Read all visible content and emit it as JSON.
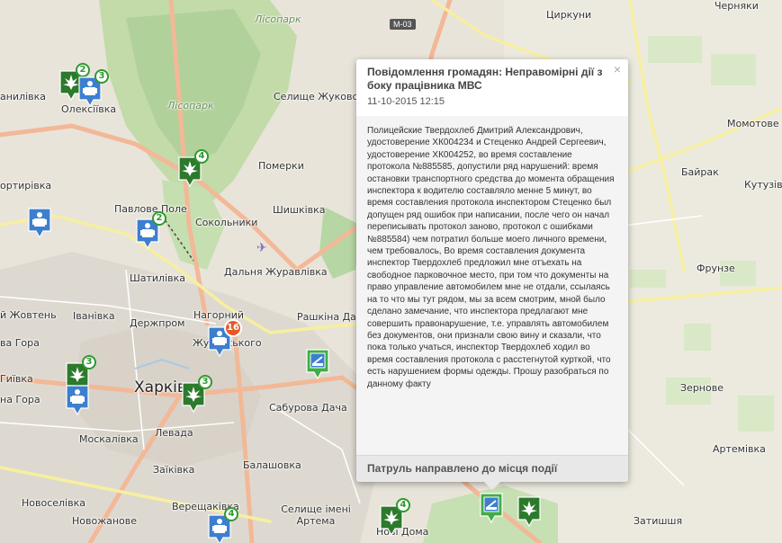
{
  "map": {
    "places": [
      {
        "name": "Черняки",
        "key": "chernyaky"
      },
      {
        "name": "Циркуни",
        "key": "tsyrkuny"
      },
      {
        "name": "Лісопарк",
        "key": "lisopark1"
      },
      {
        "name": "Лісопарк",
        "key": "lisopark2"
      },
      {
        "name": "Селище Жуковського",
        "key": "zhukovskoho"
      },
      {
        "name": "Олексіївка",
        "key": "oleksiivka"
      },
      {
        "name": "анилівка",
        "key": "danylivka"
      },
      {
        "name": "Померки",
        "key": "pomerky"
      },
      {
        "name": "Момотове",
        "key": "momotove"
      },
      {
        "name": "ортирівка",
        "key": "fortyrivka"
      },
      {
        "name": "Павлове Поле",
        "key": "pavlove-pole"
      },
      {
        "name": "Сокольники",
        "key": "sokolnyky"
      },
      {
        "name": "Шишківка",
        "key": "shyshkivka"
      },
      {
        "name": "Байрак",
        "key": "bairak"
      },
      {
        "name": "Кутузів",
        "key": "kutuziv"
      },
      {
        "name": "Шатилівка",
        "key": "shatylivka"
      },
      {
        "name": "Дальня Журавлівка",
        "key": "dalnia-zhuravlivka"
      },
      {
        "name": "Фрунзе",
        "key": "frunze"
      },
      {
        "name": "й Жовтень",
        "key": "zhovten"
      },
      {
        "name": "Іванівка",
        "key": "ivanivka"
      },
      {
        "name": "Держпром",
        "key": "derzhprom"
      },
      {
        "name": "Нагорний",
        "key": "nahornyi"
      },
      {
        "name": "Рашкіна Дача",
        "key": "rashkina-dacha"
      },
      {
        "name": "Жуковського",
        "key": "zhukovskoho2"
      },
      {
        "name": "ва Гора",
        "key": "lysa-hora"
      },
      {
        "name": "Гиївка",
        "key": "hyivka"
      },
      {
        "name": "Харків",
        "key": "kharkiv"
      },
      {
        "name": "на Гора",
        "key": "holodna-hora"
      },
      {
        "name": "Сабурова Дача",
        "key": "saburova-dacha"
      },
      {
        "name": "Зернове",
        "key": "zernove"
      },
      {
        "name": "Москалівка",
        "key": "moskalivka"
      },
      {
        "name": "Левада",
        "key": "levada"
      },
      {
        "name": "Артемівка",
        "key": "artemivka"
      },
      {
        "name": "Заїківка",
        "key": "zaikivka"
      },
      {
        "name": "Балашовка",
        "key": "balashovka"
      },
      {
        "name": "Новоселівка",
        "key": "novoselivka"
      },
      {
        "name": "Верещаківка",
        "key": "vereshchakivka"
      },
      {
        "name": "Селище імені Артема",
        "key": "artema"
      },
      {
        "name": "Нові Дома",
        "key": "novi-doma"
      },
      {
        "name": "Новожанове",
        "key": "novozhanove"
      },
      {
        "name": "Затишшя",
        "key": "zatyshshia"
      }
    ],
    "road_label": "М-03",
    "markers": [
      {
        "type": "cannabis",
        "badge": "2",
        "key": "m1"
      },
      {
        "type": "police",
        "badge": "3",
        "key": "m2"
      },
      {
        "type": "cannabis",
        "badge": "4",
        "key": "m3"
      },
      {
        "type": "police",
        "badge": "",
        "key": "m4"
      },
      {
        "type": "police",
        "badge": "2",
        "key": "m5"
      },
      {
        "type": "police",
        "badge": "16",
        "key": "m6"
      },
      {
        "type": "patrol",
        "badge": "",
        "key": "m7"
      },
      {
        "type": "cannabis",
        "badge": "3",
        "key": "m8"
      },
      {
        "type": "police",
        "badge": "",
        "key": "m9"
      },
      {
        "type": "cannabis",
        "badge": "3",
        "key": "m10"
      },
      {
        "type": "police",
        "badge": "4",
        "key": "m11"
      },
      {
        "type": "cannabis",
        "badge": "4",
        "key": "m12"
      },
      {
        "type": "patrol",
        "badge": "",
        "key": "m13"
      },
      {
        "type": "cannabis",
        "badge": "",
        "key": "m14"
      }
    ],
    "colors": {
      "park": "#c8dfb1",
      "forest": "#aed19c",
      "road_main": "#f3c3a8",
      "road_yellow": "#f9f2a6",
      "urban": "#dcd7cf"
    }
  },
  "popup": {
    "title": "Повідомлення громадян: Неправомірні дії з боку працівника МВС",
    "date": "11-10-2015 12:15",
    "close": "×",
    "body": "Полицейские Твердохлеб Дмитрий Александрович, удостоверение ХК004234 и Стеценко Андрей Сергеевич, удостоверение ХК004252, во время составление протокола №885585, допустили ряд нарушений: время остановки транспортного средства до момента обращения инспектора к водителю составляло менне 5 минут, во время составления протокола инспектором Стеценко был допущен ряд ошибок при написании, после чего он начал переписывать протокол заново, протокол с ошибками №885584) чем потратил больше моего личного времени, чем требовалось, Во время составления документа инспектор Твердохлеб предложил мне отъехать на свободное парковочное место, при том что документы на право управление автомобилем мне не отдали, ссылаясь на то что мы тут рядом, мы за всем смотрим, мной было сделано замечание, что инспектора предлагают мне совершить правонарушение, т.е. управлять автомобилем без документов, они признали свою вину и сказали, что пока только учаться, инспектор Твердохлеб ходил во время составления протокола с расстегнутой курткой, что есть нарушением формы одежды. Прошу разобраться по данному факту",
    "footer": "Патруль направлено до місця події"
  }
}
